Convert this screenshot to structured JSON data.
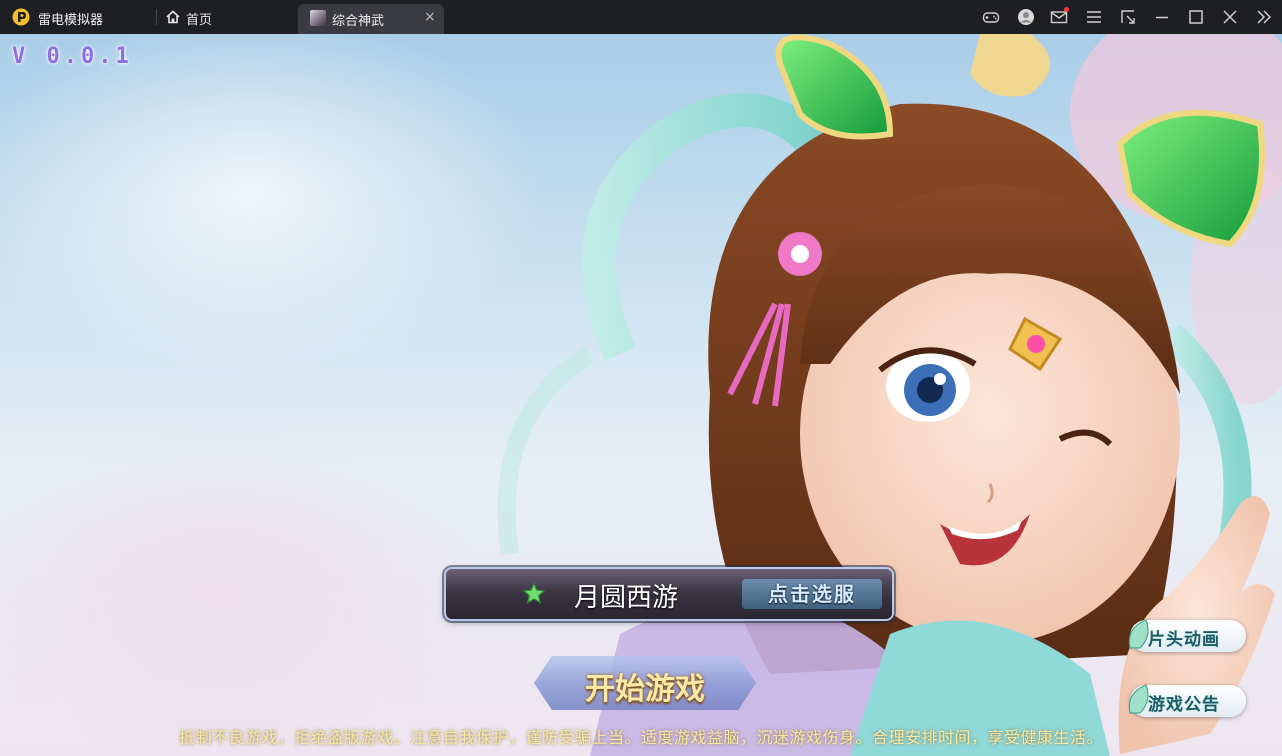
{
  "titlebar": {
    "app_name": "雷电模拟器",
    "home_tab_label": "首页",
    "game_tab_label": "综合神武",
    "close_glyph": "×",
    "icons": [
      "gamepad-icon",
      "user-avatar-icon",
      "mail-icon",
      "menu-icon",
      "resize-icon",
      "minimize-icon",
      "maximize-icon",
      "close-icon",
      "collapse-sidebar-icon"
    ],
    "accent": "#f5c02a",
    "notification_color": "#ff3b3b"
  },
  "game": {
    "version": "V 0.0.1",
    "server": {
      "name": "月圆西游",
      "choose_label": "点击选服"
    },
    "start_label": "开始游戏",
    "side_buttons": {
      "intro_animation": "片头动画",
      "announcement": "游戏公告"
    },
    "health_notice": "抵制不良游戏，拒绝盗版游戏。注意自我保护，谨防受骗上当。适度游戏益脑，沉迷游戏伤身。合理安排时间，享受健康生活。"
  }
}
